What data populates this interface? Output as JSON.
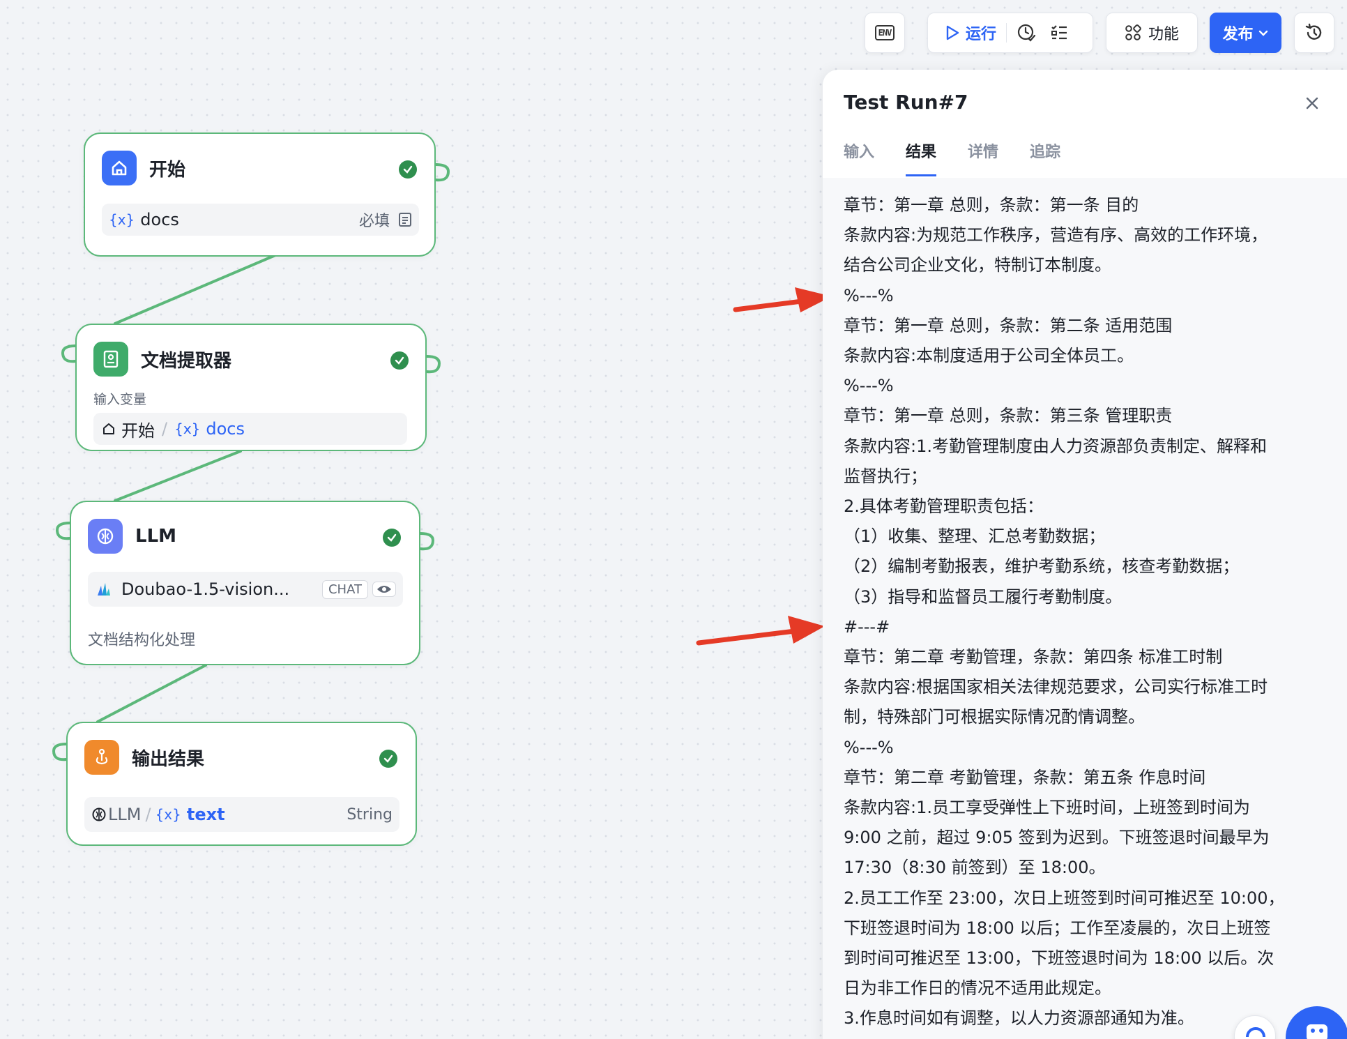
{
  "toolbar": {
    "env_icon": "ENV",
    "run_label": "运行",
    "func_label": "功能",
    "publish_label": "发布"
  },
  "nodes": {
    "start": {
      "title": "开始",
      "var_name": "docs",
      "required": "必填"
    },
    "extractor": {
      "title": "文档提取器",
      "input_label": "输入变量",
      "source_node": "开始",
      "source_var": "docs"
    },
    "llm": {
      "title": "LLM",
      "model": "Doubao-1.5-vision...",
      "model_tag": "CHAT",
      "description": "文档结构化处理"
    },
    "output": {
      "title": "输出结果",
      "source_node": "LLM",
      "var": "text",
      "type": "String"
    }
  },
  "panel": {
    "title": "Test Run#7",
    "tabs": [
      "输入",
      "结果",
      "详情",
      "追踪"
    ],
    "active_tab": "结果",
    "lines": [
      "章节：第一章 总则，条款：第一条 目的",
      "条款内容:为规范工作秩序，营造有序、高效的工作环境，",
      "结合公司企业文化，特制订本制度。",
      "%---%",
      "章节：第一章 总则，条款：第二条 适用范围",
      "条款内容:本制度适用于公司全体员工。",
      "%---%",
      "章节：第一章 总则，条款：第三条 管理职责",
      "条款内容:1.考勤管理制度由人力资源部负责制定、解释和",
      "监督执行；",
      "2.具体考勤管理职责包括：",
      "（1）收集、整理、汇总考勤数据；",
      "（2）编制考勤报表，维护考勤系统，核查考勤数据；",
      "（3）指导和监督员工履行考勤制度。",
      "#---#",
      "章节：第二章 考勤管理，条款：第四条 标准工时制",
      "条款内容:根据国家相关法律规范要求，公司实行标准工时",
      "制，特殊部门可根据实际情况酌情调整。",
      "%---%",
      "章节：第二章 考勤管理，条款：第五条 作息时间",
      "条款内容:1.员工享受弹性上下班时间，上班签到时间为",
      "9:00 之前，超过 9:05 签到为迟到。下班签退时间最早为",
      "17:30（8:30 前签到）至 18:00。",
      "2.员工工作至 23:00，次日上班签到时间可推迟至 10:00，",
      "下班签退时间为 18:00 以后；工作至凌晨的，次日上班签",
      "到时间可推迟至 13:00，下班签退时间为 18:00 以后。次",
      "日为非工作日的情况不适用此规定。",
      "3.作息时间如有调整，以人力资源部通知为准。"
    ]
  },
  "colors": {
    "accent": "#2d64f5",
    "node_border": "#5cb87a",
    "success": "#2f8f4e",
    "annotation_arrow": "#e53a26"
  }
}
